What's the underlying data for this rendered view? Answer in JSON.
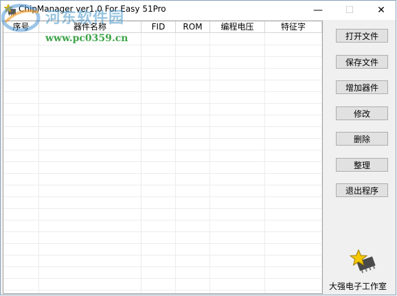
{
  "window": {
    "title": "ChipManager ver1.0 For Easy 51Pro",
    "app_icon": "star-chip-icon",
    "controls": {
      "minimize": "—",
      "maximize": "☐",
      "close": "✕"
    }
  },
  "table": {
    "columns": [
      "序号",
      "器件名称",
      "FID",
      "ROM",
      "编程电压",
      "特征字"
    ],
    "rows": []
  },
  "sidebar": {
    "buttons": [
      "打开文件",
      "保存文件",
      "增加器件",
      "修改",
      "删除",
      "整理",
      "退出程序"
    ]
  },
  "footer": {
    "studio_name": "大强电子工作室",
    "logo_icon": "star-chip-icon"
  },
  "watermark": {
    "site_name": "河东软件园",
    "url": "www.pc0359.cn"
  },
  "colors": {
    "accent_watermark_url": "#3fa44a",
    "button_face": "#e1e1e1",
    "window_bg": "#f0f0f0"
  }
}
